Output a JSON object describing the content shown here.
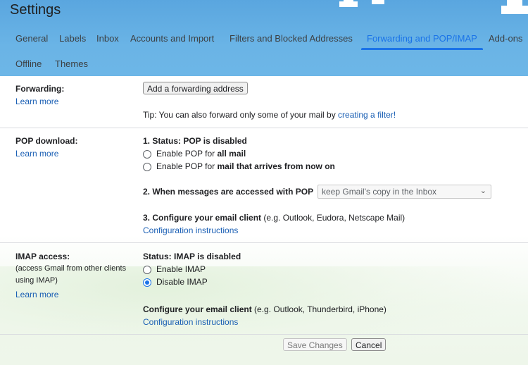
{
  "page": {
    "title": "Settings"
  },
  "tabs": [
    {
      "label": "General"
    },
    {
      "label": "Labels"
    },
    {
      "label": "Inbox"
    },
    {
      "label": "Accounts and Import"
    },
    {
      "label": "Filters and Blocked Addresses"
    },
    {
      "label": "Forwarding and POP/IMAP"
    },
    {
      "label": "Add-ons"
    },
    {
      "label": "Offline"
    },
    {
      "label": "Themes"
    }
  ],
  "forwarding": {
    "label": "Forwarding:",
    "learn_more": "Learn more",
    "add_button": "Add a forwarding address",
    "tip_prefix": "Tip: You can also forward only some of your mail by ",
    "tip_link": "creating a filter!"
  },
  "pop": {
    "label": "POP download:",
    "learn_more": "Learn more",
    "status": "1. Status: POP is disabled",
    "opt1_prefix": "Enable POP for ",
    "opt1_bold": "all mail",
    "opt2_prefix": "Enable POP for ",
    "opt2_bold": "mail that arrives from now on",
    "access_label": "2. When messages are accessed with POP",
    "access_value": "keep Gmail's copy in the Inbox",
    "configure_bold": "3. Configure your email client",
    "configure_rest": " (e.g. Outlook, Eudora, Netscape Mail)",
    "config_link": "Configuration instructions"
  },
  "imap": {
    "label": "IMAP access:",
    "sub1": "(access Gmail from other clients",
    "sub2": "using IMAP)",
    "learn_more": "Learn more",
    "status": "Status: IMAP is disabled",
    "enable": "Enable IMAP",
    "disable": "Disable IMAP",
    "selected": "Disable IMAP",
    "configure_bold": "Configure your email client",
    "configure_rest": " (e.g. Outlook, Thunderbird, iPhone)",
    "config_link": "Configuration instructions"
  },
  "footer": {
    "save": "Save Changes",
    "cancel": "Cancel"
  },
  "colors": {
    "accent": "#1a73e8",
    "link": "#1a5fb4"
  }
}
